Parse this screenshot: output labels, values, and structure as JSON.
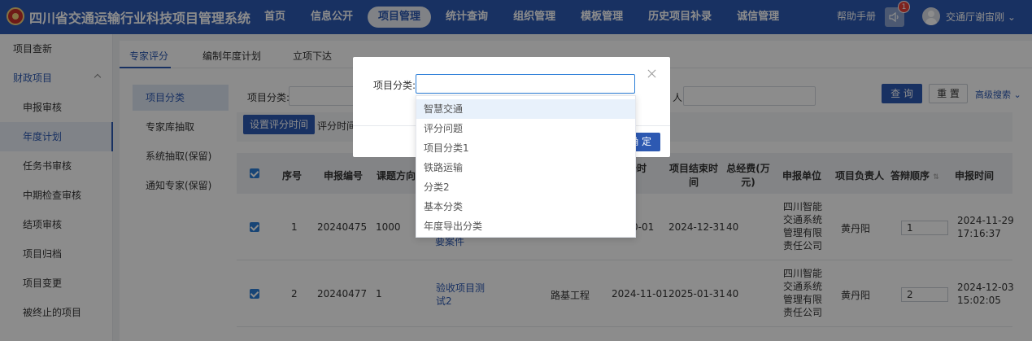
{
  "app": {
    "title": "四川省交通运输行业科技项目管理系统",
    "help": "帮助手册",
    "notification_count": "1",
    "user": "交通厅谢宙刚"
  },
  "nav": [
    {
      "label": "首页"
    },
    {
      "label": "信息公开"
    },
    {
      "label": "项目管理",
      "active": true
    },
    {
      "label": "统计查询"
    },
    {
      "label": "组织管理"
    },
    {
      "label": "模板管理"
    },
    {
      "label": "历史项目补录"
    },
    {
      "label": "诚信管理"
    }
  ],
  "sidebar": {
    "items": [
      {
        "label": "项目查新"
      },
      {
        "label": "财政项目"
      },
      {
        "label": "申报审核"
      },
      {
        "label": "年度计划"
      },
      {
        "label": "任务书审核"
      },
      {
        "label": "中期检查审核"
      },
      {
        "label": "结项审核"
      },
      {
        "label": "项目归档"
      },
      {
        "label": "项目变更"
      },
      {
        "label": "被终止的项目"
      }
    ]
  },
  "tabs": [
    {
      "label": "专家评分"
    },
    {
      "label": "编制年度计划"
    },
    {
      "label": "立项下达"
    }
  ],
  "subnav": [
    {
      "label": "项目分类"
    },
    {
      "label": "专家库抽取"
    },
    {
      "label": "系统抽取(保留)"
    },
    {
      "label": "通知专家(保留)"
    }
  ],
  "filters": {
    "category_label": "项目分类:",
    "person_label": "人:",
    "search_btn": "查 询",
    "reset_btn": "重 置",
    "advanced": "高级搜索",
    "set_time_btn": "设置评分时间",
    "score_time_label": "评分时间"
  },
  "table": {
    "headers": {
      "seq": "序号",
      "code": "申报编号",
      "direction": "课题方向",
      "start": "始时",
      "end_line1": "项目结束时",
      "end_line2": "间",
      "fund_line1": "总经费(万",
      "fund_line2": "元)",
      "unit": "申报单位",
      "leader": "项目负责人",
      "order": "答辩顺序",
      "date": "申报时间"
    },
    "rows": [
      {
        "seq": "1",
        "code": "20240475",
        "direction": "1000",
        "name_partial": "要案件",
        "field": "",
        "start": "0-01",
        "end": "2024-12-31",
        "fund": "40",
        "unit": "四川智能交通系统管理有限责任公司",
        "leader": "黄丹阳",
        "order": "1",
        "date": "2024-11-29",
        "time": "17:16:37"
      },
      {
        "seq": "2",
        "code": "20240477",
        "direction": "1",
        "name_line1": "验收项目测",
        "name_line2": "试2",
        "field": "路基工程",
        "start": "2024-11-01",
        "end": "2025-01-31",
        "fund": "40",
        "unit": "四川智能交通系统管理有限责任公司",
        "leader": "黄丹阳",
        "order": "2",
        "date": "2024-12-03",
        "time": "15:02:05"
      }
    ]
  },
  "modal": {
    "label": "项目分类:",
    "input_value": "",
    "ok": "确 定",
    "options": [
      "智慧交通",
      "评分问题",
      "项目分类1",
      "铁路运输",
      "分类2",
      "基本分类",
      "年度导出分类"
    ]
  }
}
